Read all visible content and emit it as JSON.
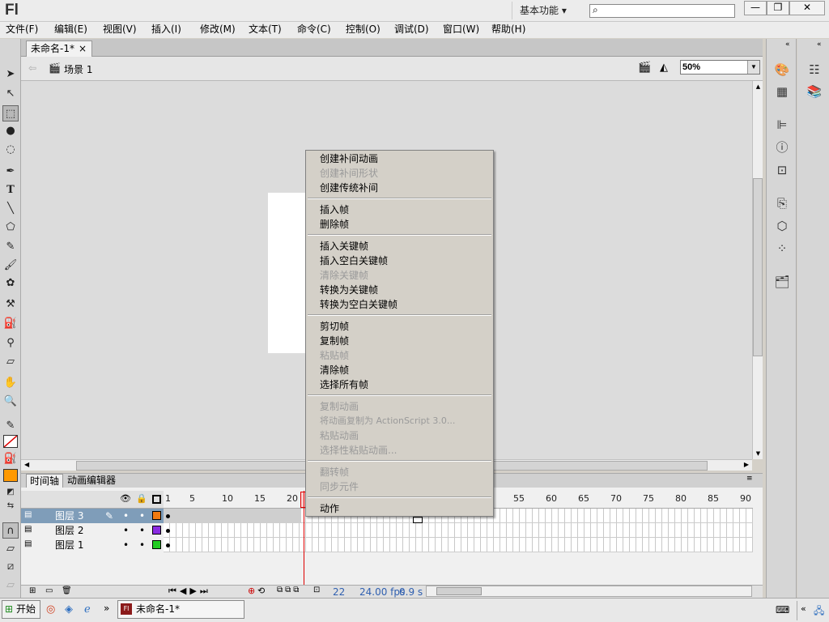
{
  "app": {
    "logo": "Fl",
    "workspace": "基本功能 ▾",
    "search_placeholder": ""
  },
  "window_buttons": {
    "minimize": "—",
    "restore": "❐",
    "close": "✕"
  },
  "menubar": [
    "文件(F)",
    "编辑(E)",
    "视图(V)",
    "插入(I)",
    "修改(M)",
    "文本(T)",
    "命令(C)",
    "控制(O)",
    "调试(D)",
    "窗口(W)",
    "帮助(H)"
  ],
  "document": {
    "tab_title": "未命名-1*",
    "tab_close": "×",
    "scene": "场景 1",
    "zoom": "50%"
  },
  "timeline": {
    "tabs": [
      "时间轴",
      "动画编辑器"
    ],
    "layers": [
      "图层 3",
      "图层 2",
      "图层 1"
    ],
    "layer_colors": [
      "#f07a10",
      "#8a2be2",
      "#22cc22"
    ],
    "frame_numbers": [
      "1",
      "5",
      "10",
      "15",
      "20",
      "55",
      "60",
      "65",
      "70",
      "75",
      "80",
      "85",
      "90"
    ],
    "current_frame": "22",
    "fps": "24.00 fps",
    "time": "0.9 s"
  },
  "context_menu": [
    {
      "label": "创建补间动画",
      "disabled": false
    },
    {
      "label": "创建补间形状",
      "disabled": true
    },
    {
      "label": "创建传统补间",
      "disabled": false
    },
    {
      "label": "插入帧",
      "disabled": false
    },
    {
      "label": "删除帧",
      "disabled": false
    },
    {
      "label": "插入关键帧",
      "disabled": false
    },
    {
      "label": "插入空白关键帧",
      "disabled": false
    },
    {
      "label": "清除关键帧",
      "disabled": true
    },
    {
      "label": "转换为关键帧",
      "disabled": false
    },
    {
      "label": "转换为空白关键帧",
      "disabled": false
    },
    {
      "label": "剪切帧",
      "disabled": false
    },
    {
      "label": "复制帧",
      "disabled": false
    },
    {
      "label": "粘贴帧",
      "disabled": true
    },
    {
      "label": "清除帧",
      "disabled": false
    },
    {
      "label": "选择所有帧",
      "disabled": false
    },
    {
      "label": "复制动画",
      "disabled": true
    },
    {
      "label": "将动画复制为 ActionScript 3.0...",
      "disabled": true
    },
    {
      "label": "粘贴动画",
      "disabled": true
    },
    {
      "label": "选择性粘贴动画...",
      "disabled": true
    },
    {
      "label": "翻转帧",
      "disabled": true
    },
    {
      "label": "同步元件",
      "disabled": true
    },
    {
      "label": "动作",
      "disabled": false
    }
  ],
  "taskbar": {
    "start": "开始",
    "app": "未命名-1*"
  }
}
